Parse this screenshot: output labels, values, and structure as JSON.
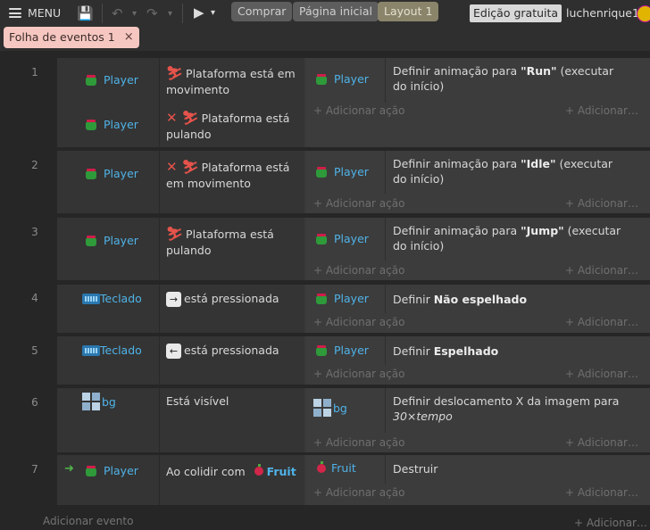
{
  "toolbar": {
    "menu_label": "MENU",
    "buy_label": "Comprar",
    "home_label": "Página inicial",
    "layout_label": "Layout 1",
    "edition_label": "Edição gratuita",
    "username": "luchenrique1"
  },
  "editor_tab": {
    "label": "Folha de eventos 1",
    "close": "×"
  },
  "common": {
    "add_action": "+ Adicionar ação",
    "add_action_short": "+ Adicionar…",
    "add_event": "Adicionar evento"
  },
  "events": [
    {
      "number": "1",
      "conditions": [
        {
          "object": "Player",
          "text": "Plataforma está em movimento",
          "inverted": false
        },
        {
          "object": "Player",
          "text": "Plataforma está pulando",
          "inverted": true
        }
      ],
      "action": {
        "object": "Player",
        "text_pre": "Definir animação para ",
        "text_bold": "\"Run\"",
        "text_post": " (executar do início)"
      }
    },
    {
      "number": "2",
      "conditions": [
        {
          "object": "Player",
          "text": "Plataforma está em movimento",
          "inverted": true
        }
      ],
      "action": {
        "object": "Player",
        "text_pre": "Definir animação para ",
        "text_bold": "\"Idle\"",
        "text_post": " (executar do início)"
      }
    },
    {
      "number": "3",
      "conditions": [
        {
          "object": "Player",
          "text": "Plataforma está pulando",
          "inverted": false
        }
      ],
      "action": {
        "object": "Player",
        "text_pre": "Definir animação para ",
        "text_bold": "\"Jump\"",
        "text_post": " (executar do início)"
      }
    },
    {
      "number": "4",
      "conditions": [
        {
          "object": "Teclado",
          "key": "→",
          "text": "está pressionada"
        }
      ],
      "action": {
        "object": "Player",
        "text_pre": "Definir ",
        "text_bold": "Não espelhado",
        "text_post": ""
      }
    },
    {
      "number": "5",
      "conditions": [
        {
          "object": "Teclado",
          "key": "←",
          "text": "está pressionada"
        }
      ],
      "action": {
        "object": "Player",
        "text_pre": "Definir ",
        "text_bold": "Espelhado",
        "text_post": ""
      }
    },
    {
      "number": "6",
      "conditions": [
        {
          "object": "bg",
          "text": "Está visível"
        }
      ],
      "action": {
        "object": "bg",
        "text_pre": "Definir deslocamento X da imagem para ",
        "text_italic": "30×tempo"
      }
    },
    {
      "number": "7",
      "conditions": [
        {
          "object": "Player",
          "text": "Ao colidir com",
          "target": "Fruit"
        }
      ],
      "action": {
        "object": "Fruit",
        "text_pre": "Destruir"
      }
    }
  ],
  "colors": {
    "accent_blue": "#4fb3e8",
    "tab_pink": "#f6c7c1",
    "negation_red": "#e5534b",
    "trigger_green": "#4fb34a"
  }
}
